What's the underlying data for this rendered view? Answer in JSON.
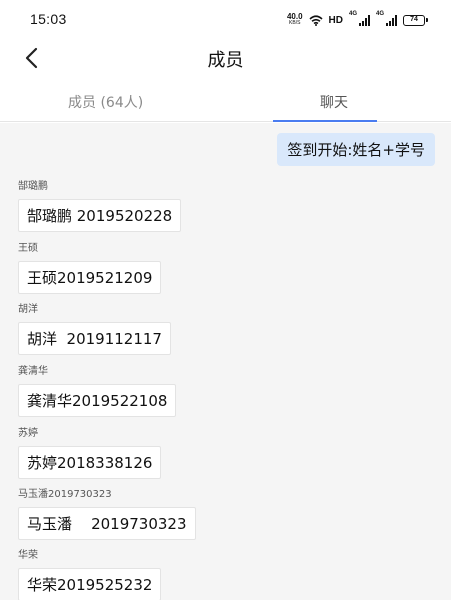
{
  "status_bar": {
    "time": "15:03",
    "net_speed_value": "40.0",
    "net_speed_unit": "KB/S",
    "hd_label": "HD",
    "signal_1_label": "4G",
    "signal_2_label": "4G",
    "battery_level": "74"
  },
  "header": {
    "title": "成员",
    "back_icon": "chevron-left-icon"
  },
  "tabs": [
    {
      "label": "成员 (64人)",
      "active": false
    },
    {
      "label": "聊天",
      "active": true
    }
  ],
  "colors": {
    "accent": "#4a7cf0",
    "my_bubble_bg": "#d9e8fb",
    "chat_bg": "#f5f5f5"
  },
  "chat": {
    "my_message": "签到开始:姓名+学号",
    "messages": [
      {
        "sender": "郜璐鹏",
        "text": "郜璐鹏 2019520228"
      },
      {
        "sender": "王硕",
        "text": "王硕2019521209"
      },
      {
        "sender": "胡洋",
        "text": "胡洋  2019112117"
      },
      {
        "sender": "龚清华",
        "text": "龚清华2019522108"
      },
      {
        "sender": "苏婷",
        "text": "苏婷2018338126"
      },
      {
        "sender": "马玉潘2019730323",
        "text": "马玉潘    2019730323"
      },
      {
        "sender": "华荣",
        "text": "华荣2019525232"
      }
    ]
  }
}
